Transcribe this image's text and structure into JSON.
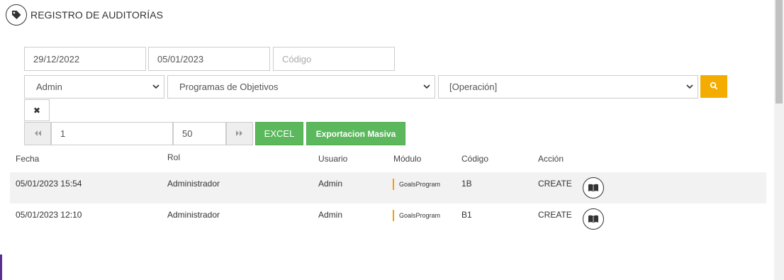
{
  "header": {
    "title": "REGISTRO DE AUDITORÍAS",
    "icon": "tag-icon"
  },
  "filters": {
    "date_from": "29/12/2022",
    "date_to": "05/01/2023",
    "code_placeholder": "Código",
    "code_value": "",
    "role_select": "Admin",
    "module_select": "Programas de Objetivos",
    "operation_select": "[Operación]",
    "clear_symbol": "✖"
  },
  "pagination": {
    "page": "1",
    "page_size": "50"
  },
  "actions": {
    "excel_label": "EXCEL",
    "bulk_export_label": "Exportacion Masiva"
  },
  "table": {
    "headers": {
      "fecha": "Fecha",
      "rol": "Rol",
      "usuario": "Usuario",
      "modulo": "Módulo",
      "codigo": "Código",
      "accion": "Acción"
    },
    "rows": [
      {
        "fecha": "05/01/2023 15:54",
        "rol": "Administrador",
        "usuario": "Admin",
        "modulo": "GoalsProgram",
        "codigo": "1B",
        "accion": "CREATE"
      },
      {
        "fecha": "05/01/2023 12:10",
        "rol": "Administrador",
        "usuario": "Admin",
        "modulo": "GoalsProgram",
        "codigo": "B1",
        "accion": "CREATE"
      }
    ]
  },
  "colors": {
    "accent_yellow": "#f5ac00",
    "green": "#5cb85c",
    "module_marker": "#f5a000",
    "left_accent": "#5b2d8e"
  }
}
